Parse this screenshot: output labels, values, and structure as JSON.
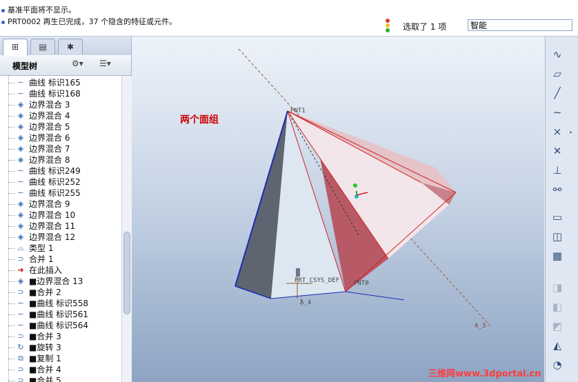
{
  "messages": [
    "基准平面将不显示。",
    "PRT0002 再生已完成，37 个隐含的特征或元件。"
  ],
  "status": {
    "selected": "选取了 1 项",
    "filter": "智能"
  },
  "tabs": [
    "model-tree-icon",
    "layers-icon",
    "favorites-icon"
  ],
  "tree": {
    "title": "模型树",
    "items": [
      {
        "icon": "curve-icon",
        "label": "曲线 标识165"
      },
      {
        "icon": "curve-icon",
        "label": "曲线 标识168"
      },
      {
        "icon": "blend-surface-icon",
        "label": "边界混合 3"
      },
      {
        "icon": "blend-surface-icon",
        "label": "边界混合 4"
      },
      {
        "icon": "blend-surface-icon",
        "label": "边界混合 5"
      },
      {
        "icon": "blend-surface-icon",
        "label": "边界混合 6"
      },
      {
        "icon": "blend-surface-icon",
        "label": "边界混合 7"
      },
      {
        "icon": "blend-surface-icon",
        "label": "边界混合 8"
      },
      {
        "icon": "curve-icon",
        "label": "曲线 标识249"
      },
      {
        "icon": "curve-icon",
        "label": "曲线 标识252"
      },
      {
        "icon": "curve-icon",
        "label": "曲线 标识255"
      },
      {
        "icon": "blend-surface-icon",
        "label": "边界混合 9"
      },
      {
        "icon": "blend-surface-icon",
        "label": "边界混合 10"
      },
      {
        "icon": "blend-surface-icon",
        "label": "边界混合 11"
      },
      {
        "icon": "blend-surface-icon",
        "label": "边界混合 12"
      },
      {
        "icon": "shape-icon",
        "label": "类型 1"
      },
      {
        "icon": "merge-icon",
        "label": "合并 1"
      },
      {
        "icon": "insert-arrow-icon",
        "label": "在此插入"
      },
      {
        "icon": "blend-surface-icon",
        "label": "■边界混合 13"
      },
      {
        "icon": "merge-icon",
        "label": "■合并 2"
      },
      {
        "icon": "curve-icon",
        "label": "■曲线 标识558"
      },
      {
        "icon": "curve-icon",
        "label": "■曲线 标识561"
      },
      {
        "icon": "curve-icon",
        "label": "■曲线 标识564"
      },
      {
        "icon": "merge-icon",
        "label": "■合并 3"
      },
      {
        "icon": "revolve-icon",
        "label": "■旋转 3"
      },
      {
        "icon": "copy-icon",
        "label": "■复制 1"
      },
      {
        "icon": "merge-icon",
        "label": "■合并 4"
      },
      {
        "icon": "merge-icon",
        "label": "■合并 5"
      }
    ]
  },
  "viewport": {
    "annotation": "两个面组",
    "labels": {
      "pnt1": "PNT1",
      "pnt0": "PNT0",
      "csys": "PRT_CSYS_DEF",
      "a4": "A_4",
      "a3": "A_3"
    },
    "watermark": "三维网www.3dportal.cn"
  },
  "colors": {
    "accent": "#cc0000",
    "surface_red": "#c0606a",
    "edge_blue": "#1e2bb0"
  }
}
